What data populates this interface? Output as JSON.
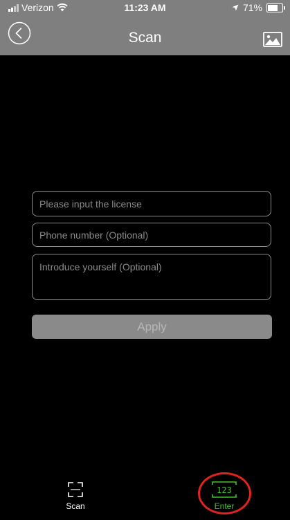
{
  "status_bar": {
    "carrier": "Verizon",
    "time": "11:23 AM",
    "battery": "71%",
    "battery_level": 0.71
  },
  "nav": {
    "title": "Scan",
    "back_icon": "back-circle-icon",
    "gallery_icon": "image-gallery-icon"
  },
  "form": {
    "license_placeholder": "Please input the license",
    "license_value": "",
    "phone_placeholder": "Phone number (Optional)",
    "phone_value": "",
    "intro_placeholder": "Introduce yourself (Optional)",
    "intro_value": "",
    "apply_label": "Apply"
  },
  "tabs": [
    {
      "label": "Scan",
      "icon": "scan-frame-icon",
      "color": "#ffffff",
      "selected": false
    },
    {
      "label": "Enter",
      "icon": "keypad-123-icon",
      "color": "#43c02b",
      "selected": true
    }
  ],
  "colors": {
    "header_bg": "#7f7f7f",
    "background": "#000000",
    "accent_green": "#43c02b",
    "highlight_red": "#e0231f"
  }
}
